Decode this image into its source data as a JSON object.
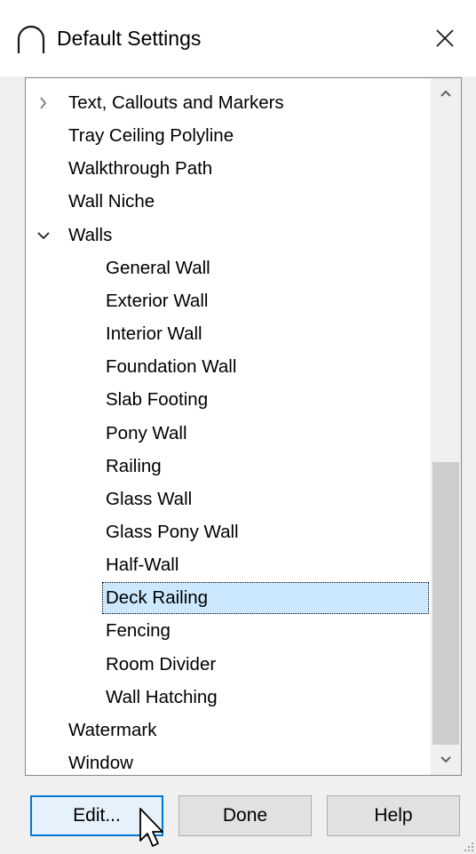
{
  "window": {
    "title": "Default Settings",
    "close_symbol": "×"
  },
  "tree": {
    "items": [
      {
        "label": "Text, Callouts and Markers",
        "level": 0,
        "expander": "collapsed"
      },
      {
        "label": "Tray Ceiling Polyline",
        "level": 0
      },
      {
        "label": "Walkthrough Path",
        "level": 0
      },
      {
        "label": "Wall Niche",
        "level": 0
      },
      {
        "label": "Walls",
        "level": 0,
        "expander": "expanded"
      },
      {
        "label": "General Wall",
        "level": 1
      },
      {
        "label": "Exterior Wall",
        "level": 1
      },
      {
        "label": "Interior Wall",
        "level": 1
      },
      {
        "label": "Foundation Wall",
        "level": 1
      },
      {
        "label": "Slab Footing",
        "level": 1
      },
      {
        "label": "Pony Wall",
        "level": 1
      },
      {
        "label": "Railing",
        "level": 1
      },
      {
        "label": "Glass Wall",
        "level": 1
      },
      {
        "label": "Glass Pony Wall",
        "level": 1
      },
      {
        "label": "Half-Wall",
        "level": 1
      },
      {
        "label": "Deck Railing",
        "level": 1,
        "selected": true
      },
      {
        "label": "Fencing",
        "level": 1
      },
      {
        "label": "Room Divider",
        "level": 1
      },
      {
        "label": "Wall Hatching",
        "level": 1
      },
      {
        "label": "Watermark",
        "level": 0
      },
      {
        "label": "Window",
        "level": 0
      }
    ]
  },
  "scroll": {
    "position_fraction": 0.55,
    "visible_fraction": 0.41
  },
  "buttons": {
    "edit": "Edit...",
    "done": "Done",
    "help": "Help"
  },
  "colors": {
    "selection": "#cce8ff",
    "default_button_border": "#0078d7"
  }
}
